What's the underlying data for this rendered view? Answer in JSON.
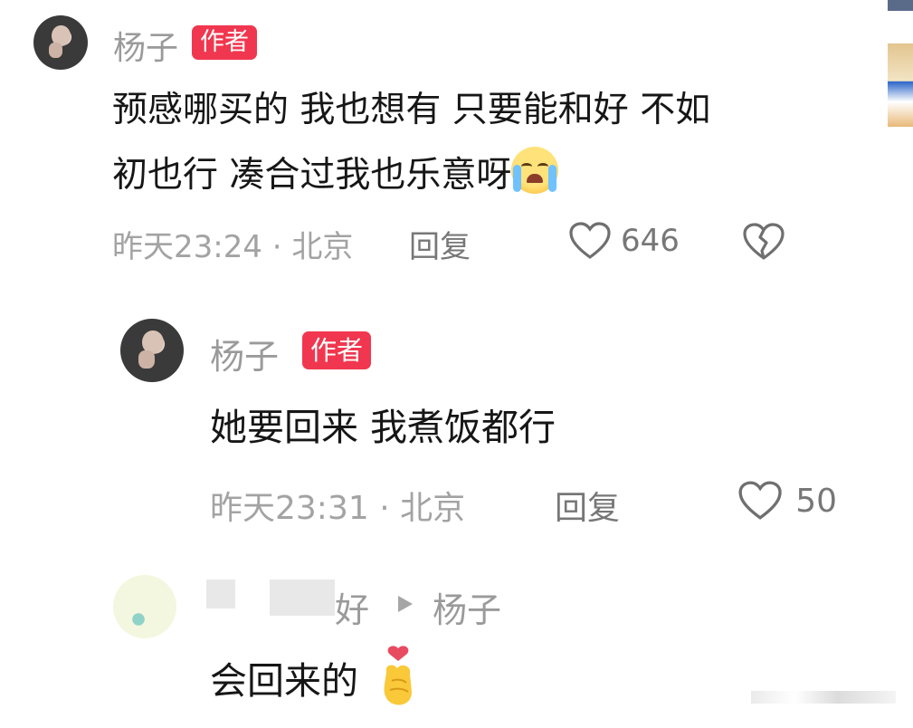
{
  "comments": [
    {
      "author": "杨子",
      "badge": "作者",
      "text_line1": "预感哪买的 我也想有 只要能和好 不如",
      "text_line2": "初也行 凑合过我也乐意呀",
      "time_location": "昨天23:24 · 北京",
      "reply_label": "回复",
      "likes": "646"
    },
    {
      "author": "杨子",
      "badge": "作者",
      "text": "她要回来 我煮饭都行",
      "time_location": "昨天23:31 · 北京",
      "reply_label": "回复",
      "likes": "50"
    },
    {
      "author_visible": "好",
      "reply_to": "杨子",
      "text": "会回来的"
    }
  ],
  "icons": {
    "like": "heart-outline-icon",
    "dislike": "broken-heart-icon",
    "cry": "crying-face-emoji",
    "finger_heart": "finger-heart-emoji",
    "reply_arrow": "play-arrow-icon"
  },
  "colors": {
    "badge_bg": "#f0374f",
    "name": "#9a9a9a",
    "meta": "#a3a3a3"
  }
}
